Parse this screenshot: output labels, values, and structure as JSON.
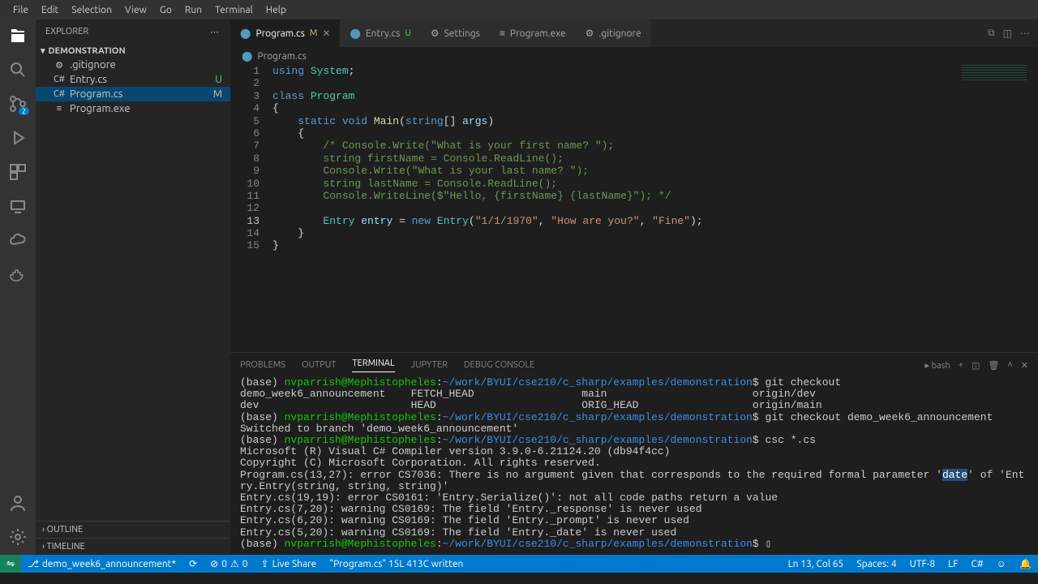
{
  "menu": [
    "File",
    "Edit",
    "Selection",
    "View",
    "Go",
    "Run",
    "Terminal",
    "Help"
  ],
  "explorer": {
    "title": "EXPLORER",
    "folder": "DEMONSTRATION",
    "files": [
      {
        "name": ".gitignore",
        "status": "",
        "icon": "⚙"
      },
      {
        "name": "Entry.cs",
        "status": "U",
        "statusClass": "",
        "icon": "C#"
      },
      {
        "name": "Program.cs",
        "status": "M",
        "statusClass": "mod",
        "icon": "C#",
        "selected": true
      },
      {
        "name": "Program.exe",
        "status": "",
        "icon": "≡"
      }
    ],
    "outline": "OUTLINE",
    "timeline": "TIMELINE"
  },
  "tabs": [
    {
      "label": "Program.cs",
      "badge": "M",
      "badgeClass": "tm",
      "active": true,
      "close": true
    },
    {
      "label": "Entry.cs",
      "badge": "U",
      "badgeClass": "tu"
    },
    {
      "label": "Settings",
      "icon": "⚙"
    },
    {
      "label": "Program.exe",
      "icon": "≡"
    },
    {
      "label": ".gitignore",
      "icon": "⚙"
    }
  ],
  "breadcrumb": "Program.cs",
  "code": {
    "lines": [
      {
        "n": 1,
        "html": "<span class='k'>using</span> <span class='t'>System</span>;"
      },
      {
        "n": 2,
        "html": ""
      },
      {
        "n": 3,
        "html": "<span class='k'>class</span> <span class='t'>Program</span>"
      },
      {
        "n": 4,
        "html": "{"
      },
      {
        "n": 5,
        "html": "    <span class='k'>static</span> <span class='k'>void</span> <span class='m'>Main</span>(<span class='k'>string</span>[] <span class='v'>args</span>)"
      },
      {
        "n": 6,
        "html": "    {"
      },
      {
        "n": 7,
        "html": "        <span class='c'>/* Console.Write(\"What is your first name? \");</span>"
      },
      {
        "n": 8,
        "html": "        <span class='c'>string firstName = Console.ReadLine();</span>"
      },
      {
        "n": 9,
        "html": "        <span class='c'>Console.Write(\"What is your last name? \");</span>"
      },
      {
        "n": 10,
        "html": "        <span class='c'>string lastName = Console.ReadLine();</span>"
      },
      {
        "n": 11,
        "html": "        <span class='c'>Console.WriteLine($\"Hello, {firstName} {lastName}\"); */</span>"
      },
      {
        "n": 12,
        "html": ""
      },
      {
        "n": 13,
        "html": "        <span class='t'>Entry</span> <span class='v'>entry</span> = <span class='k'>new</span> <span class='t'>Entry</span>(<span class='s'>\"1/1/1970\"</span>, <span class='s'>\"How are you?\"</span>, <span class='s'>\"Fine\"</span>);",
        "current": true
      },
      {
        "n": 14,
        "html": "    }"
      },
      {
        "n": 15,
        "html": "}"
      }
    ]
  },
  "panel": {
    "tabs": [
      "PROBLEMS",
      "OUTPUT",
      "TERMINAL",
      "JUPYTER",
      "DEBUG CONSOLE"
    ],
    "active": "TERMINAL",
    "shell": "bash"
  },
  "terminal_lines": [
    "(base) <span class='tg'>nvparrish@Mephistopheles</span>:<span class='tb'>~/work/BYUI/cse210/c_sharp/examples/demonstration</span>$ git checkout ",
    "demo_week6_announcement    FETCH_HEAD                 main                       origin/dev",
    "dev                        HEAD                       ORIG_HEAD                  origin/main",
    "(base) <span class='tg'>nvparrish@Mephistopheles</span>:<span class='tb'>~/work/BYUI/cse210/c_sharp/examples/demonstration</span>$ git checkout demo_week6_announcement ",
    "Switched to branch 'demo_week6_announcement'",
    "(base) <span class='tg'>nvparrish@Mephistopheles</span>:<span class='tb'>~/work/BYUI/cse210/c_sharp/examples/demonstration</span>$ csc *.cs",
    "Microsoft (R) Visual C# Compiler version 3.9.0-6.21124.20 (db94f4cc)",
    "Copyright (C) Microsoft Corporation. All rights reserved.",
    "",
    "Program.cs(13,27): error CS7036: There is no argument given that corresponds to the required formal parameter '<span class='th'>date</span>' of 'Entry.Entry(string, string, string)'",
    "Entry.cs(19,19): error CS0161: 'Entry.Serialize()': not all code paths return a value",
    "Entry.cs(7,20): warning CS0169: The field 'Entry._response' is never used",
    "Entry.cs(6,20): warning CS0169: The field 'Entry._prompt' is never used",
    "Entry.cs(5,20): warning CS0169: The field 'Entry._date' is never used",
    "(base) <span class='tg'>nvparrish@Mephistopheles</span>:<span class='tb'>~/work/BYUI/cse210/c_sharp/examples/demonstration</span>$ ▯"
  ],
  "status": {
    "branch": "demo_week6_announcement*",
    "errors": "0",
    "warnings": "0",
    "liveshare": "Live Share",
    "fileinfo": "\"Program.cs\" 15L 413C written",
    "lncol": "Ln 13, Col 65",
    "spaces": "Spaces: 4",
    "encoding": "UTF-8",
    "eol": "LF",
    "lang": "C#"
  },
  "scm_badge": "2"
}
